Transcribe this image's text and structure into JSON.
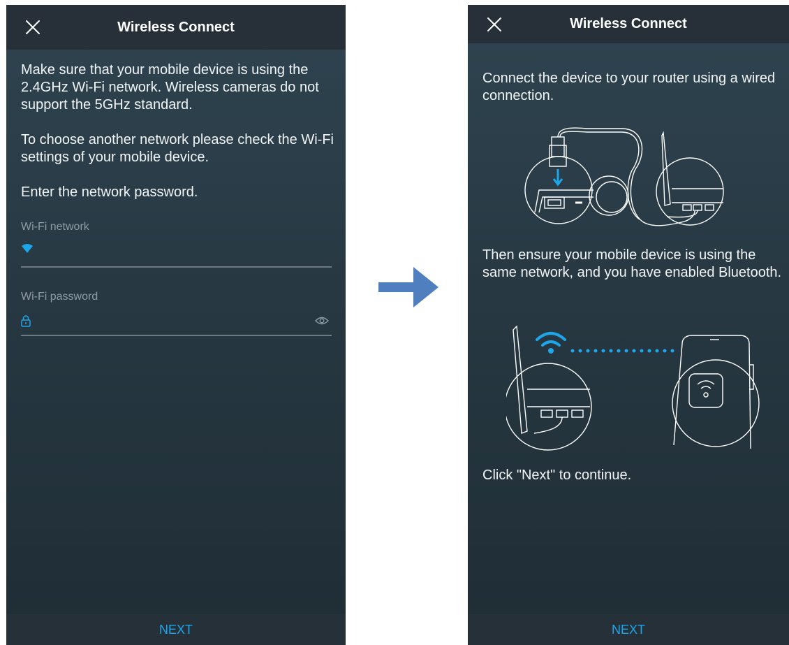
{
  "left_screen": {
    "title": "Wireless Connect",
    "close_icon": "close-icon",
    "paragraphs": [
      "Make sure that your mobile device is using the 2.4GHz Wi-Fi network. Wireless cameras do not support the 5GHz standard.",
      "To choose another network please check the Wi-Fi settings of your mobile device.",
      "Enter the network password."
    ],
    "wifi_network": {
      "label": "Wi-Fi network",
      "value": "",
      "icon": "wifi-icon"
    },
    "wifi_password": {
      "label": "Wi-Fi password",
      "value": "",
      "icon": "lock-icon",
      "toggle_icon": "eye-icon"
    },
    "next_label": "NEXT"
  },
  "right_screen": {
    "title": "Wireless Connect",
    "close_icon": "close-icon",
    "paragraphs": [
      "Connect the device to your router using a wired connection.",
      "Then ensure your mobile device is using the same network, and you have enabled Bluetooth.",
      "Click \"Next\" to continue."
    ],
    "next_label": "NEXT"
  },
  "colors": {
    "accent": "#1ea6ea",
    "header_bg": "#273038",
    "screen_bg": "#2b3e4a",
    "arrow": "#4f7fbf"
  }
}
